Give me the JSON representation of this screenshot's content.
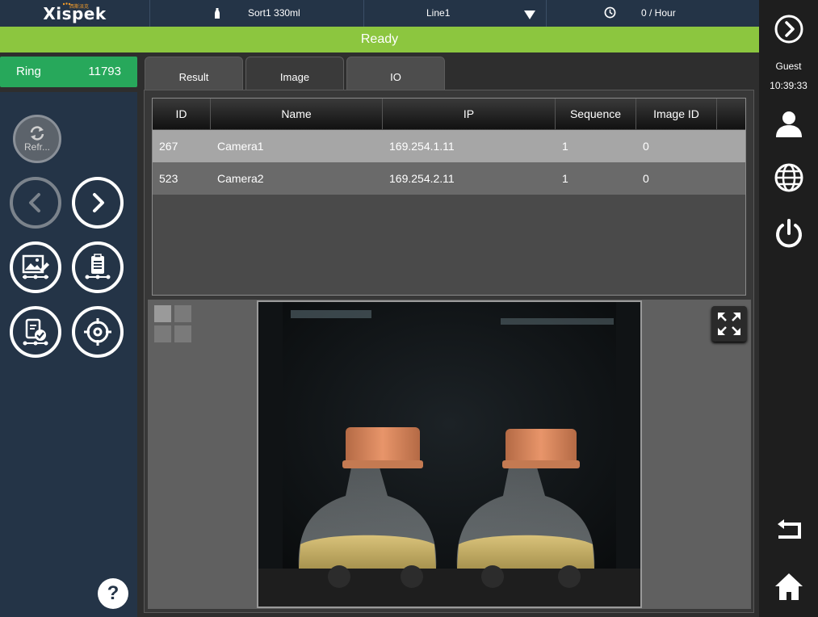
{
  "app": {
    "logo_text": "Xispek",
    "logo_sub": "西斯派克"
  },
  "topbar": {
    "product": "Sort1 330ml",
    "line": "Line1",
    "rate": "0 / Hour"
  },
  "status": {
    "text": "Ready",
    "color": "#8cc63f"
  },
  "ring": {
    "label": "Ring",
    "value": "11793"
  },
  "left_controls": {
    "refresh_label": "Refr...",
    "help_label": "?"
  },
  "tabs": [
    {
      "label": "Result",
      "active": false
    },
    {
      "label": "Image",
      "active": true
    },
    {
      "label": "IO",
      "active": false
    }
  ],
  "table": {
    "columns": [
      "ID",
      "Name",
      "IP",
      "Sequence",
      "Image ID"
    ],
    "rows": [
      [
        "267",
        "Camera1",
        "169.254.1.11",
        "1",
        "0"
      ],
      [
        "523",
        "Camera2",
        "169.254.2.11",
        "1",
        "0"
      ]
    ]
  },
  "right_sidebar": {
    "user": "Guest",
    "time": "10:39:33",
    "icons": [
      "forward-circle-icon",
      "user-icon",
      "globe-icon",
      "power-icon",
      "return-icon",
      "home-icon"
    ]
  }
}
